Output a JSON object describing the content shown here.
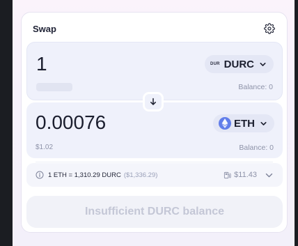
{
  "swap": {
    "title": "Swap"
  },
  "sell": {
    "amount": "1",
    "token_logo_text": "DUR",
    "token": "DURC",
    "balance": "Balance: 0"
  },
  "buy": {
    "amount": "0.00076",
    "usd_value": "$1.02",
    "token": "ETH",
    "balance": "Balance: 0"
  },
  "rate": {
    "text": "1 ETH = 1,310.29 DURC",
    "usd": "($1,336.29)",
    "gas": "$11.43"
  },
  "submit": {
    "label": "Insufficient DURC balance"
  },
  "colors": {
    "eth": "#627eea",
    "panel": "#eff1fb",
    "disabled_text": "#c4c7d6"
  },
  "icons": {
    "settings": "gear-icon",
    "switch": "arrow-down-icon",
    "info": "info-icon",
    "gas": "gas-pump-icon",
    "expand": "chevron-down-icon"
  }
}
